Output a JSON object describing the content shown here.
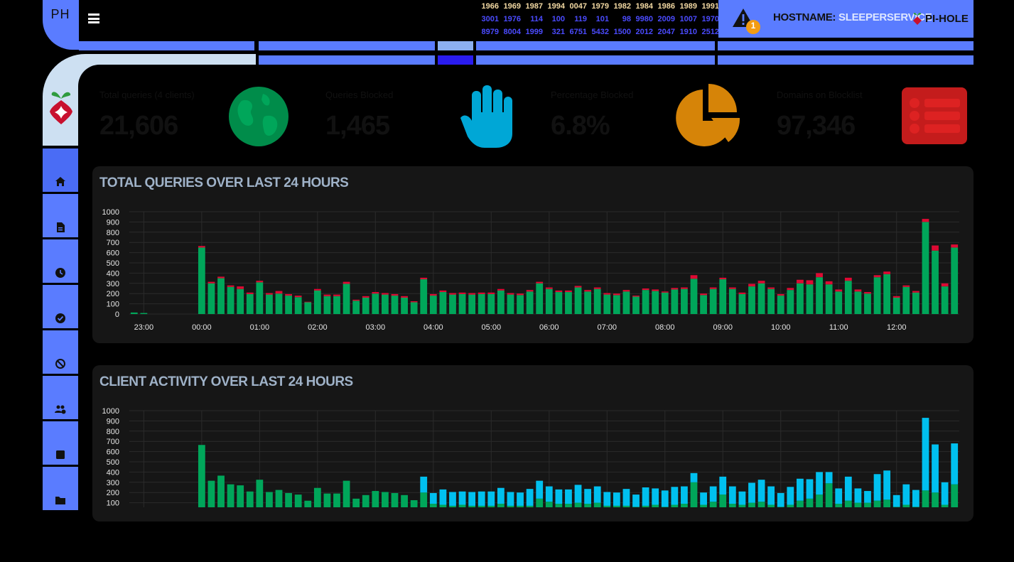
{
  "header": {
    "logo": "PH",
    "menu_icon": "hamburger-icon",
    "numbers": [
      [
        "1966",
        "3001",
        "8979"
      ],
      [
        "1969",
        "1976",
        "8004"
      ],
      [
        "1987",
        "114",
        "1999"
      ],
      [
        "1994",
        "100",
        "321"
      ],
      [
        "0047",
        "119",
        "6751"
      ],
      [
        "1979",
        "101",
        "5432"
      ],
      [
        "1982",
        "98",
        "1500"
      ],
      [
        "1984",
        "9980",
        "2012"
      ],
      [
        "1986",
        "2009",
        "2047"
      ],
      [
        "1989",
        "1007",
        "1910"
      ],
      [
        "1991",
        "1970",
        "2512"
      ]
    ],
    "alert_count": "1",
    "hostname_label": "HOSTNAME:",
    "hostname_value": "SLEEPERSERVICE",
    "brand": "PI-HOLE",
    "colors": {
      "frame": "#5a7cff",
      "light": "#cde0f2"
    }
  },
  "sidebar": {
    "items": [
      {
        "icon": "home-icon"
      },
      {
        "icon": "document-icon"
      },
      {
        "icon": "clock-icon"
      },
      {
        "icon": "check-circle-icon"
      },
      {
        "icon": "ban-icon"
      },
      {
        "icon": "users-cog-icon"
      },
      {
        "icon": "stop-icon"
      },
      {
        "icon": "folder-icon"
      }
    ]
  },
  "stats": [
    {
      "label": "Total queries (4 clients)",
      "value": "21,606",
      "color": "#00a65a",
      "icon": "globe-icon"
    },
    {
      "label": "Queries Blocked",
      "value": "1,465",
      "color": "#00c0ef",
      "icon": "hand-icon"
    },
    {
      "label": "Percentage Blocked",
      "value": "6.8%",
      "color": "#f39c12",
      "icon": "pie-chart-icon"
    },
    {
      "label": "Domains on Blocklist",
      "value": "97,346",
      "color": "#dd2222",
      "icon": "list-icon"
    }
  ],
  "chart_data": [
    {
      "type": "bar",
      "title": "TOTAL QUERIES OVER LAST 24 HOURS",
      "ylim": [
        0,
        1000
      ],
      "yticks": [
        "0",
        "100",
        "200",
        "300",
        "400",
        "500",
        "600",
        "700",
        "800",
        "900",
        "1000"
      ],
      "xticks": [
        "23:00",
        "00:00",
        "01:00",
        "02:00",
        "03:00",
        "04:00",
        "05:00",
        "06:00",
        "07:00",
        "08:00",
        "09:00",
        "10:00",
        "11:00",
        "12:00"
      ],
      "x_start": "22:50",
      "interval_minutes": 10,
      "stacked": true,
      "colors": [
        "#00a65a",
        "#dd0a33"
      ],
      "series": [
        {
          "values": [
            15,
            10,
            0,
            0,
            0,
            0,
            0,
            650,
            300,
            350,
            265,
            245,
            195,
            310,
            190,
            200,
            180,
            165,
            115,
            230,
            175,
            175,
            295,
            130,
            160,
            200,
            190,
            180,
            160,
            115,
            340,
            180,
            215,
            190,
            195,
            190,
            195,
            195,
            230,
            190,
            185,
            220,
            300,
            245,
            215,
            215,
            260,
            220,
            245,
            190,
            185,
            220,
            170,
            235,
            225,
            210,
            240,
            245,
            345,
            185,
            245,
            340,
            245,
            195,
            270,
            300,
            245,
            180,
            235,
            300,
            290,
            360,
            290,
            220,
            325,
            220,
            200,
            360,
            390,
            160,
            265,
            210,
            900,
            620,
            270,
            650
          ]
        },
        {
          "values": [
            0,
            0,
            0,
            0,
            0,
            0,
            0,
            15,
            15,
            15,
            15,
            25,
            15,
            15,
            15,
            25,
            15,
            15,
            5,
            15,
            15,
            15,
            20,
            10,
            15,
            15,
            15,
            15,
            15,
            10,
            15,
            15,
            15,
            15,
            15,
            15,
            15,
            15,
            15,
            15,
            15,
            15,
            15,
            15,
            15,
            15,
            15,
            15,
            15,
            15,
            15,
            15,
            10,
            15,
            15,
            10,
            15,
            15,
            35,
            15,
            15,
            15,
            15,
            15,
            25,
            25,
            15,
            15,
            20,
            35,
            40,
            40,
            30,
            20,
            30,
            20,
            15,
            20,
            25,
            15,
            15,
            15,
            30,
            50,
            30,
            30
          ]
        }
      ]
    },
    {
      "type": "bar",
      "title": "CLIENT ACTIVITY OVER LAST 24 HOURS",
      "ylim": [
        0,
        1000
      ],
      "yticks": [
        "100",
        "200",
        "300",
        "400",
        "500",
        "600",
        "700",
        "800",
        "900",
        "1000"
      ],
      "stacked": true,
      "colors": [
        "#00a65a",
        "#00c0ef"
      ],
      "series": [
        {
          "values": [
            15,
            10,
            0,
            0,
            0,
            0,
            0,
            665,
            315,
            365,
            280,
            270,
            210,
            325,
            205,
            225,
            195,
            180,
            120,
            245,
            190,
            190,
            315,
            140,
            175,
            215,
            205,
            195,
            175,
            125,
            200,
            90,
            80,
            70,
            80,
            70,
            70,
            70,
            90,
            70,
            70,
            70,
            140,
            110,
            90,
            90,
            100,
            90,
            100,
            70,
            70,
            70,
            60,
            70,
            80,
            60,
            80,
            90,
            300,
            80,
            110,
            180,
            90,
            80,
            100,
            110,
            80,
            60,
            80,
            120,
            140,
            180,
            290,
            90,
            120,
            100,
            100,
            120,
            130,
            60,
            80,
            60,
            220,
            200,
            80,
            280
          ]
        },
        {
          "values": [
            0,
            0,
            0,
            0,
            0,
            0,
            0,
            0,
            0,
            0,
            0,
            0,
            0,
            0,
            0,
            0,
            0,
            0,
            0,
            0,
            0,
            0,
            0,
            0,
            0,
            0,
            0,
            0,
            0,
            0,
            155,
            105,
            150,
            135,
            130,
            135,
            140,
            140,
            155,
            135,
            130,
            165,
            175,
            150,
            140,
            140,
            175,
            145,
            160,
            135,
            130,
            165,
            120,
            180,
            160,
            160,
            175,
            170,
            90,
            120,
            150,
            175,
            170,
            130,
            195,
            215,
            180,
            135,
            175,
            215,
            190,
            220,
            110,
            150,
            235,
            140,
            115,
            260,
            285,
            115,
            200,
            165,
            710,
            470,
            220,
            400
          ]
        }
      ]
    }
  ]
}
